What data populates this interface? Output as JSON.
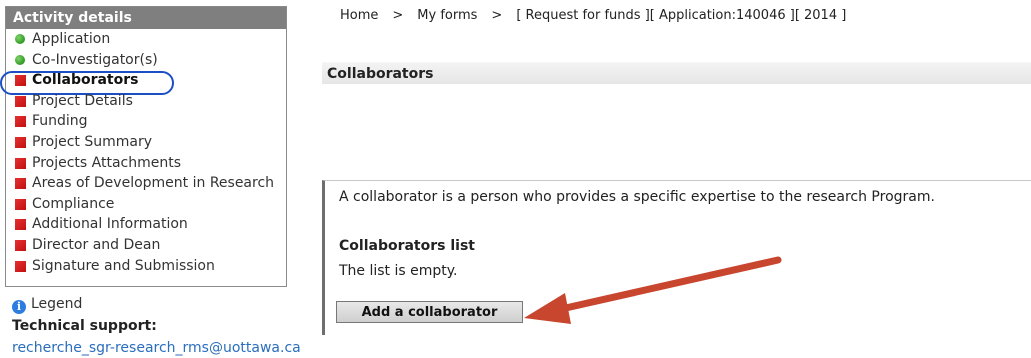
{
  "sidebar": {
    "title": "Activity details",
    "items": [
      {
        "label": "Application",
        "marker": "green-dot"
      },
      {
        "label": "Co-Investigator(s)",
        "marker": "green-dot"
      },
      {
        "label": "Collaborators",
        "marker": "red-square",
        "active": true
      },
      {
        "label": "Project Details",
        "marker": "red-square"
      },
      {
        "label": "Funding",
        "marker": "red-square"
      },
      {
        "label": "Project Summary",
        "marker": "red-square"
      },
      {
        "label": "Projects Attachments",
        "marker": "red-square"
      },
      {
        "label": "Areas of Development in Research",
        "marker": "red-square"
      },
      {
        "label": "Compliance",
        "marker": "red-square"
      },
      {
        "label": "Additional Information",
        "marker": "red-square"
      },
      {
        "label": "Director and Dean",
        "marker": "red-square"
      },
      {
        "label": "Signature and Submission",
        "marker": "red-square"
      }
    ]
  },
  "legend": {
    "label": "Legend",
    "icon": "info-icon"
  },
  "support": {
    "title": "Technical support:",
    "email": "recherche_sgr-research_rms@uottawa.ca"
  },
  "breadcrumb": {
    "home": "Home",
    "separator": ">",
    "my_forms": "My forms",
    "current": "[ Request for funds ][ Application:140046 ][ 2014 ]"
  },
  "section": {
    "title": "Collaborators"
  },
  "panel": {
    "description": "A collaborator is a person who provides a specific expertise to the research Program.",
    "list_title": "Collaborators list",
    "empty_text": "The list is empty.",
    "add_button": "Add a collaborator"
  },
  "colors": {
    "sidebar_header_bg": "#7f7f7f",
    "complete_marker": "#2f9a22",
    "incomplete_marker": "#c11010",
    "highlight_ring": "#1d4fc4",
    "annotation_arrow": "#c8452e",
    "link": "#2a6ebd"
  }
}
